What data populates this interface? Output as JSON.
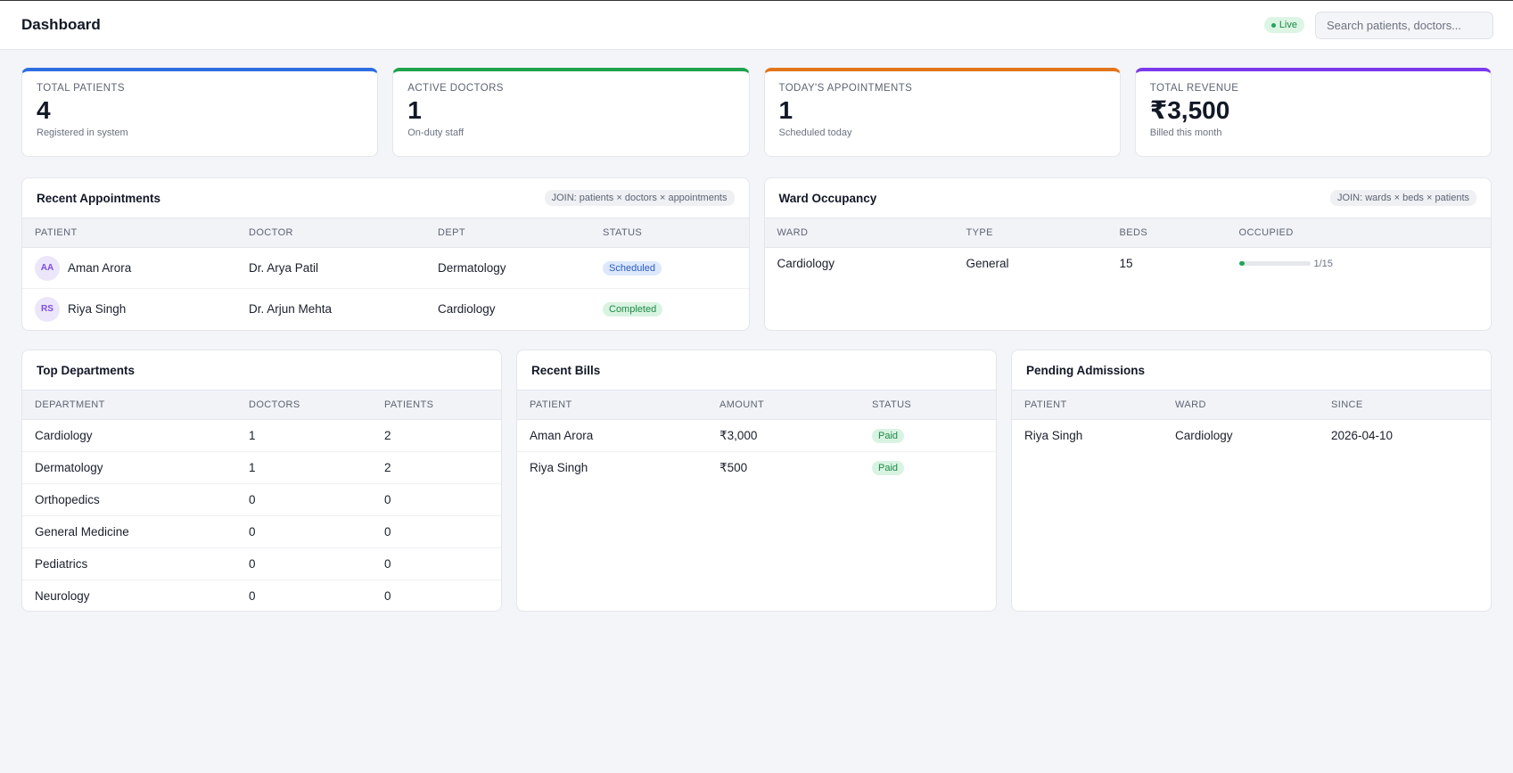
{
  "header": {
    "title": "Dashboard",
    "live_label": "Live",
    "search_placeholder": "Search patients, doctors..."
  },
  "colors": {
    "blue": "#2f6ee0",
    "green": "#1fa34c",
    "orange": "#e2751b",
    "purple": "#7c3aed"
  },
  "stats": [
    {
      "label": "Total Patients",
      "value": "4",
      "sub": "Registered in system",
      "accent": "#2f6ee0"
    },
    {
      "label": "Active Doctors",
      "value": "1",
      "sub": "On-duty staff",
      "accent": "#1fa34c"
    },
    {
      "label": "Today's Appointments",
      "value": "1",
      "sub": "Scheduled today",
      "accent": "#e2751b"
    },
    {
      "label": "Total Revenue",
      "value": "₹3,500",
      "sub": "Billed this month",
      "accent": "#7c3aed"
    }
  ],
  "appointments": {
    "title": "Recent Appointments",
    "join": "JOIN: patients × doctors × appointments",
    "columns": [
      "Patient",
      "Doctor",
      "Dept",
      "Status"
    ],
    "rows": [
      {
        "initials": "AA",
        "patient": "Aman Arora",
        "doctor": "Dr. Arya Patil",
        "dept": "Dermatology",
        "status": "Scheduled"
      },
      {
        "initials": "RS",
        "patient": "Riya Singh",
        "doctor": "Dr. Arjun Mehta",
        "dept": "Cardiology",
        "status": "Completed"
      }
    ]
  },
  "wards": {
    "title": "Ward Occupancy",
    "join": "JOIN: wards × beds × patients",
    "columns": [
      "Ward",
      "Type",
      "Beds",
      "Occupied"
    ],
    "rows": [
      {
        "ward": "Cardiology",
        "type": "General",
        "beds": "15",
        "occupied": "1/15",
        "occupied_fraction": 0.0667
      }
    ]
  },
  "departments": {
    "title": "Top Departments",
    "columns": [
      "Department",
      "Doctors",
      "Patients"
    ],
    "rows": [
      {
        "department": "Cardiology",
        "doctors": "1",
        "patients": "2"
      },
      {
        "department": "Dermatology",
        "doctors": "1",
        "patients": "2"
      },
      {
        "department": "Orthopedics",
        "doctors": "0",
        "patients": "0"
      },
      {
        "department": "General Medicine",
        "doctors": "0",
        "patients": "0"
      },
      {
        "department": "Pediatrics",
        "doctors": "0",
        "patients": "0"
      },
      {
        "department": "Neurology",
        "doctors": "0",
        "patients": "0"
      }
    ]
  },
  "bills": {
    "title": "Recent Bills",
    "columns": [
      "Patient",
      "Amount",
      "Status"
    ],
    "rows": [
      {
        "patient": "Aman Arora",
        "amount": "₹3,000",
        "status": "Paid"
      },
      {
        "patient": "Riya Singh",
        "amount": "₹500",
        "status": "Paid"
      }
    ]
  },
  "admissions": {
    "title": "Pending Admissions",
    "columns": [
      "Patient",
      "Ward",
      "Since"
    ],
    "rows": [
      {
        "patient": "Riya Singh",
        "ward": "Cardiology",
        "since": "2026-04-10"
      }
    ]
  }
}
